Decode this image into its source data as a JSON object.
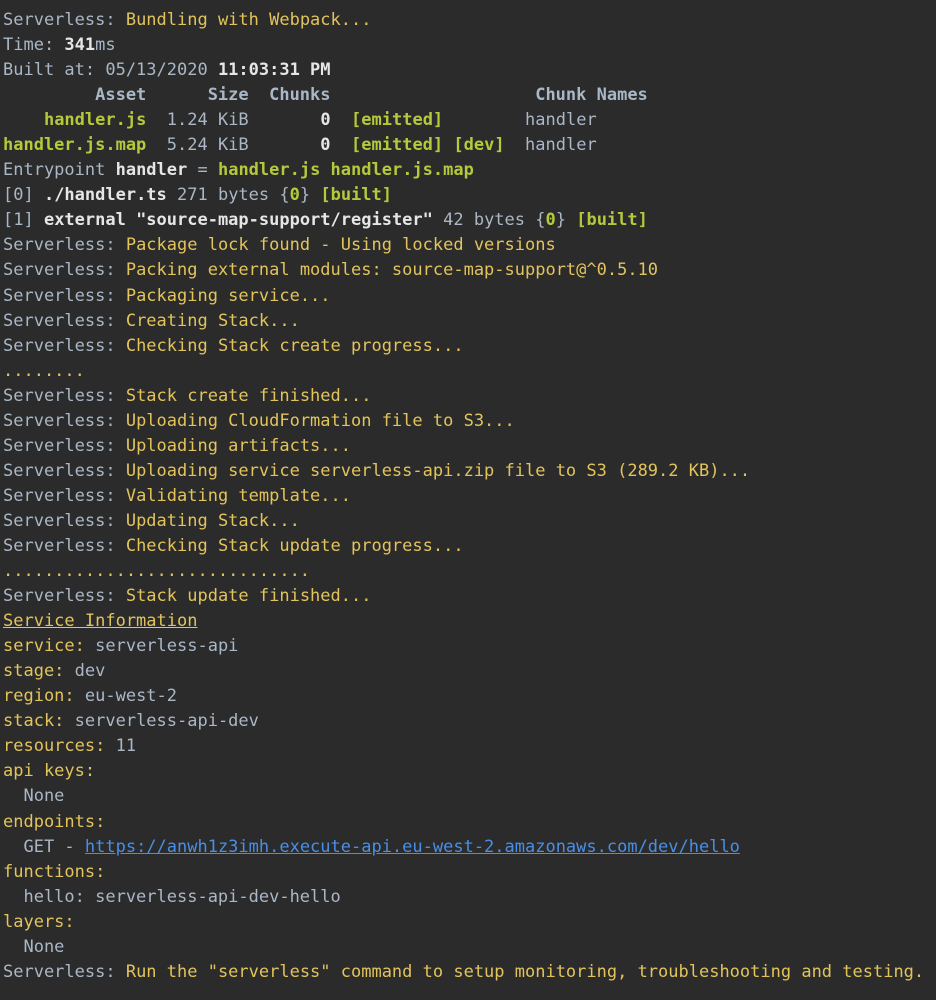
{
  "theme": {
    "background": "#2b2b2b",
    "text": "#a9b7c6",
    "yellow": "#e2c45b",
    "green": "#b5c93a",
    "link": "#4a8fe6"
  },
  "lines": [
    [
      {
        "t": "Serverless: "
      },
      {
        "t": "Bundling with Webpack...",
        "c": "y"
      }
    ],
    [
      {
        "t": "Time: "
      },
      {
        "t": "341",
        "c": "b w"
      },
      {
        "t": "ms"
      }
    ],
    [
      {
        "t": "Built at: 05/13/2020 "
      },
      {
        "t": "11:03:31 PM",
        "c": "b w"
      }
    ],
    [
      {
        "t": "         Asset      Size  Chunks                    Chunk Names",
        "c": "b"
      }
    ],
    [
      {
        "t": "    "
      },
      {
        "t": "handler.js",
        "c": "g b"
      },
      {
        "t": "  1.24 KiB       "
      },
      {
        "t": "0",
        "c": "b w"
      },
      {
        "t": "  "
      },
      {
        "t": "[emitted]",
        "c": "g b"
      },
      {
        "t": "        handler"
      }
    ],
    [
      {
        "t": "handler.js.map",
        "c": "g b"
      },
      {
        "t": "  5.24 KiB       "
      },
      {
        "t": "0",
        "c": "b w"
      },
      {
        "t": "  "
      },
      {
        "t": "[emitted] [dev]",
        "c": "g b"
      },
      {
        "t": "  handler"
      }
    ],
    [
      {
        "t": "Entrypoint "
      },
      {
        "t": "handler",
        "c": "b w"
      },
      {
        "t": " = "
      },
      {
        "t": "handler.js handler.js.map",
        "c": "g b"
      }
    ],
    [
      {
        "t": "[0] "
      },
      {
        "t": "./handler.ts",
        "c": "b w"
      },
      {
        "t": " 271 bytes {"
      },
      {
        "t": "0",
        "c": "g b"
      },
      {
        "t": "} "
      },
      {
        "t": "[built]",
        "c": "g b"
      }
    ],
    [
      {
        "t": "[1] "
      },
      {
        "t": "external \"source-map-support/register\"",
        "c": "b w"
      },
      {
        "t": " 42 bytes {"
      },
      {
        "t": "0",
        "c": "g b"
      },
      {
        "t": "} "
      },
      {
        "t": "[built]",
        "c": "g b"
      }
    ],
    [
      {
        "t": "Serverless: "
      },
      {
        "t": "Package lock found - Using locked versions",
        "c": "y"
      }
    ],
    [
      {
        "t": "Serverless: "
      },
      {
        "t": "Packing external modules: source-map-support@^0.5.10",
        "c": "y"
      }
    ],
    [
      {
        "t": "Serverless: "
      },
      {
        "t": "Packaging service...",
        "c": "y"
      }
    ],
    [
      {
        "t": "Serverless: "
      },
      {
        "t": "Creating Stack...",
        "c": "y"
      }
    ],
    [
      {
        "t": "Serverless: "
      },
      {
        "t": "Checking Stack create progress...",
        "c": "y"
      }
    ],
    [
      {
        "t": "........",
        "c": "y"
      }
    ],
    [
      {
        "t": "Serverless: "
      },
      {
        "t": "Stack create finished...",
        "c": "y"
      }
    ],
    [
      {
        "t": "Serverless: "
      },
      {
        "t": "Uploading CloudFormation file to S3...",
        "c": "y"
      }
    ],
    [
      {
        "t": "Serverless: "
      },
      {
        "t": "Uploading artifacts...",
        "c": "y"
      }
    ],
    [
      {
        "t": "Serverless: "
      },
      {
        "t": "Uploading service serverless-api.zip file to S3 (289.2 KB)...",
        "c": "y"
      }
    ],
    [
      {
        "t": "Serverless: "
      },
      {
        "t": "Validating template...",
        "c": "y"
      }
    ],
    [
      {
        "t": "Serverless: "
      },
      {
        "t": "Updating Stack...",
        "c": "y"
      }
    ],
    [
      {
        "t": "Serverless: "
      },
      {
        "t": "Checking Stack update progress...",
        "c": "y"
      }
    ],
    [
      {
        "t": "..............................",
        "c": "y"
      }
    ],
    [
      {
        "t": "Serverless: "
      },
      {
        "t": "Stack update finished...",
        "c": "y"
      }
    ],
    [
      {
        "t": "Service Information",
        "c": "y u"
      }
    ],
    [
      {
        "t": "service:",
        "c": "y"
      },
      {
        "t": " serverless-api"
      }
    ],
    [
      {
        "t": "stage:",
        "c": "y"
      },
      {
        "t": " dev"
      }
    ],
    [
      {
        "t": "region:",
        "c": "y"
      },
      {
        "t": " eu-west-2"
      }
    ],
    [
      {
        "t": "stack:",
        "c": "y"
      },
      {
        "t": " serverless-api-dev"
      }
    ],
    [
      {
        "t": "resources:",
        "c": "y"
      },
      {
        "t": " 11"
      }
    ],
    [
      {
        "t": "api keys:",
        "c": "y"
      }
    ],
    [
      {
        "t": "  None"
      }
    ],
    [
      {
        "t": "endpoints:",
        "c": "y"
      }
    ],
    [
      {
        "t": "  GET - "
      },
      {
        "t": "https://anwh1z3imh.execute-api.eu-west-2.amazonaws.com/dev/hello",
        "c": "link",
        "link": true
      }
    ],
    [
      {
        "t": "functions:",
        "c": "y"
      }
    ],
    [
      {
        "t": "  hello: serverless-api-dev-hello"
      }
    ],
    [
      {
        "t": "layers:",
        "c": "y"
      }
    ],
    [
      {
        "t": "  None"
      }
    ],
    [
      {
        "t": "Serverless: "
      },
      {
        "t": "Run the \"serverless\" command to setup monitoring, troubleshooting and testing.",
        "c": "y"
      }
    ]
  ]
}
